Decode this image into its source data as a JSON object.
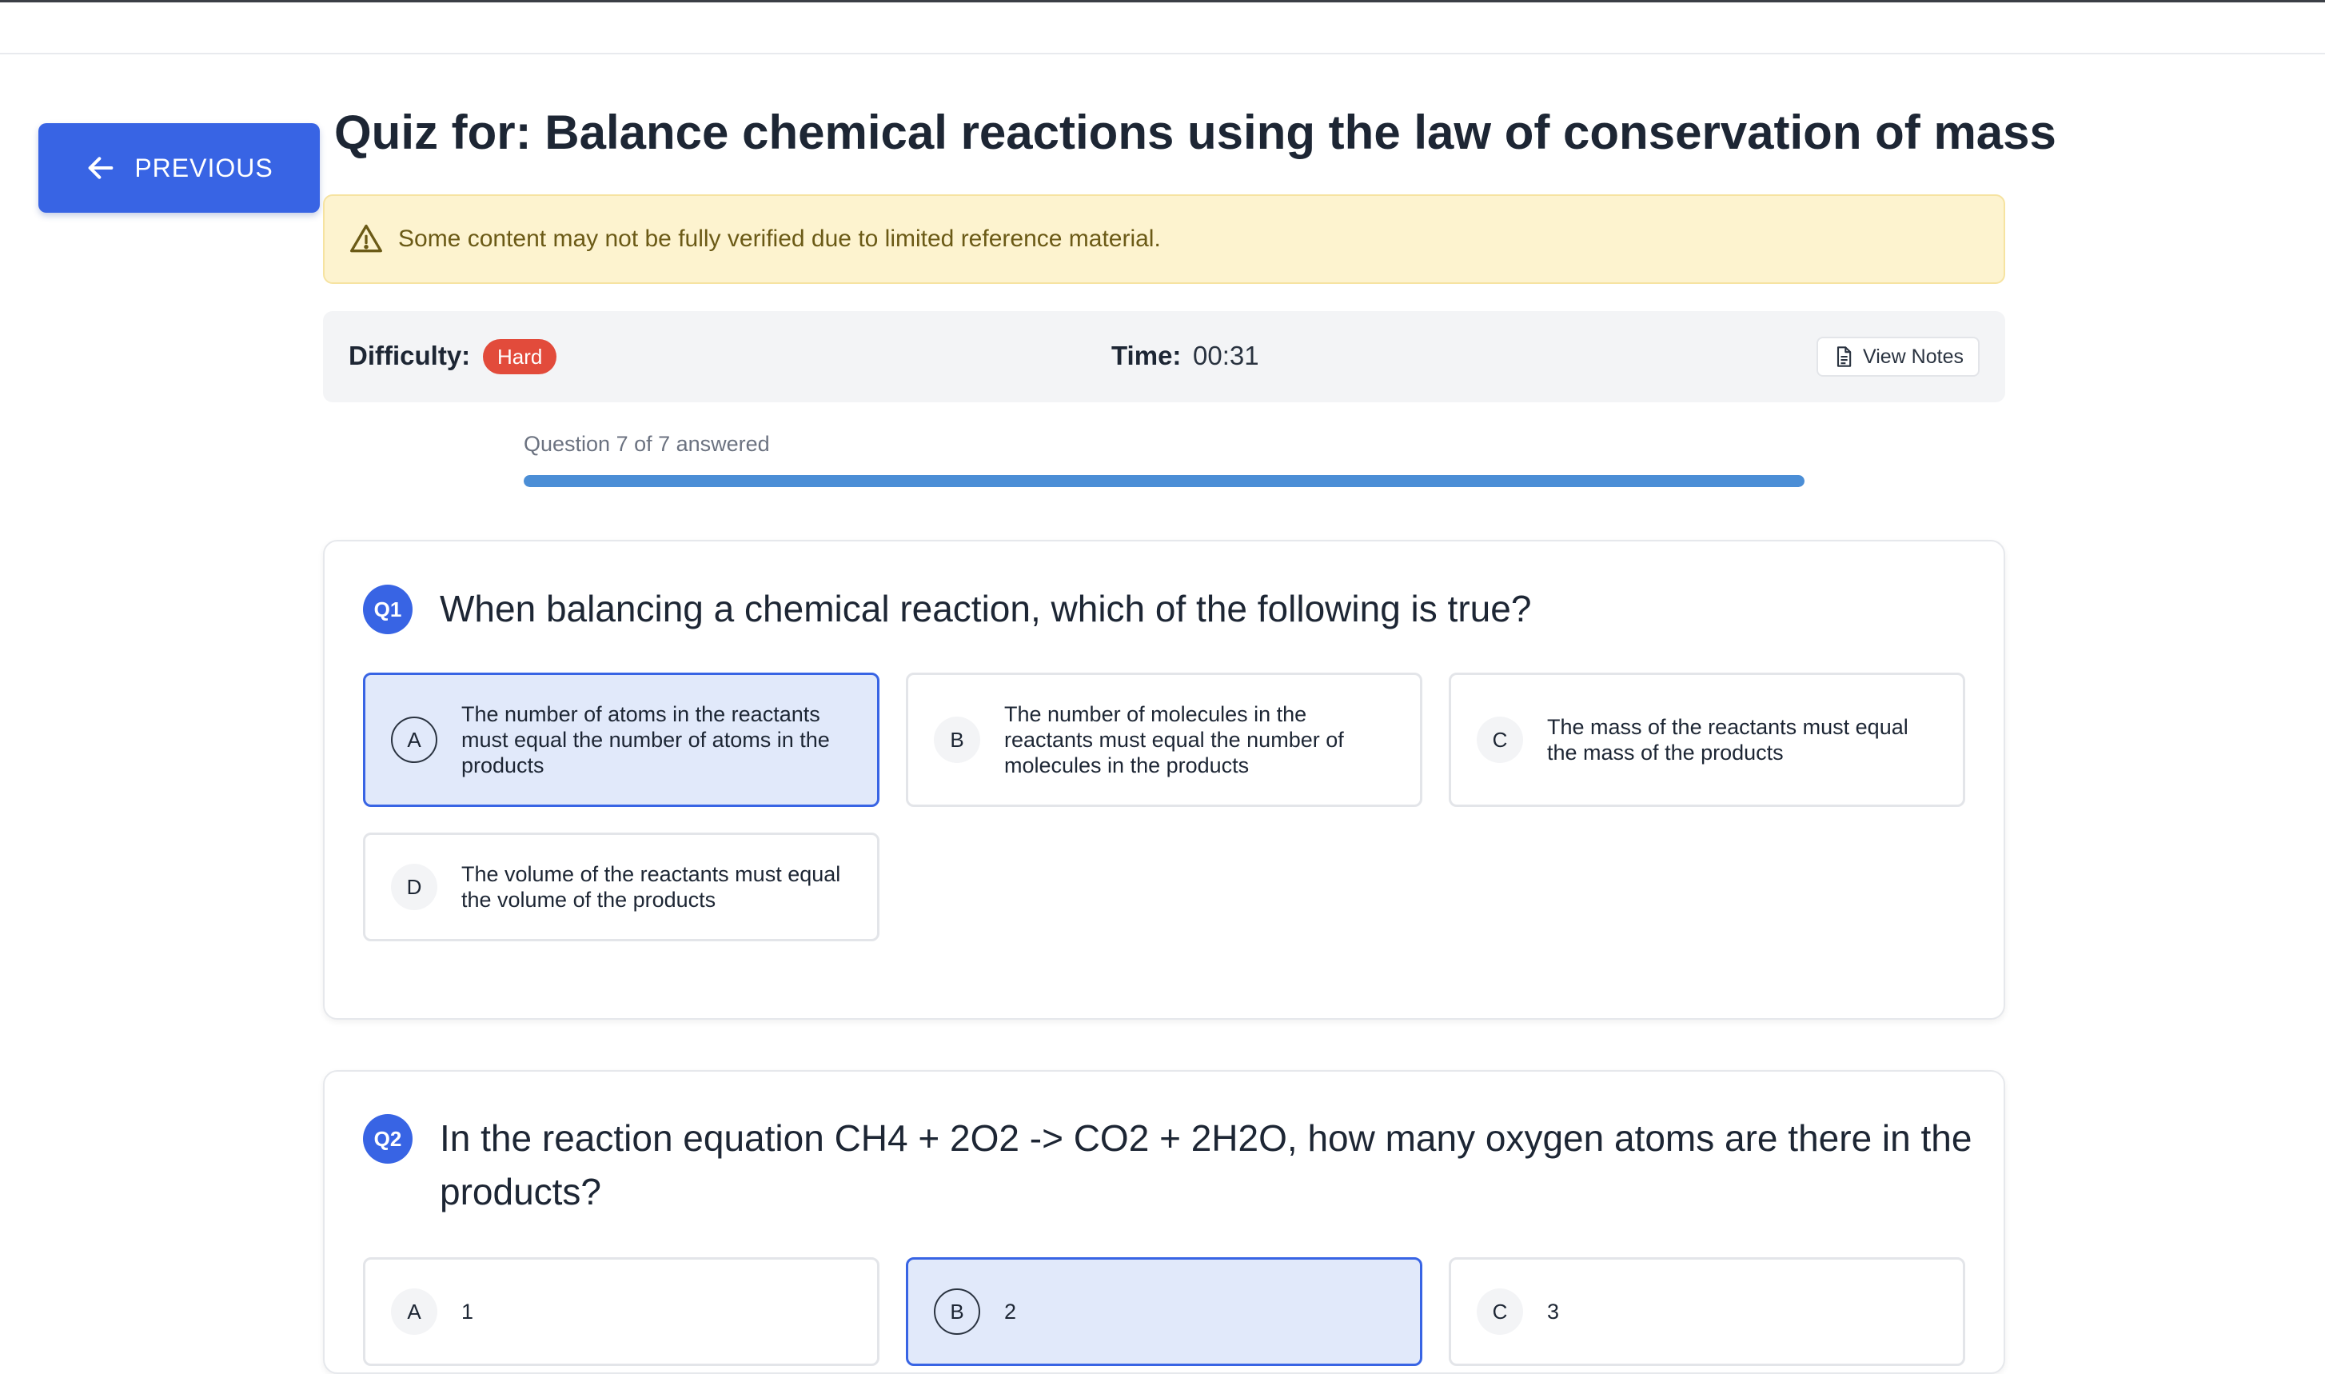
{
  "nav": {
    "previous_label": "PREVIOUS"
  },
  "quiz": {
    "title": "Quiz for: Balance chemical reactions using the law of conservation of mass",
    "warning": "Some content may not be fully verified due to limited reference material."
  },
  "info": {
    "difficulty_label": "Difficulty:",
    "difficulty_value": "Hard",
    "time_label": "Time:",
    "time_value": "00:31",
    "notes_label": "View Notes"
  },
  "progress": {
    "text": "Question 7 of 7 answered",
    "fraction": 1.0
  },
  "questions": [
    {
      "number": "Q1",
      "text": "When balancing a chemical reaction, which of the following is true?",
      "options": [
        {
          "letter": "A",
          "text": "The number of atoms in the reactants must equal the number of atoms in the products",
          "selected": true
        },
        {
          "letter": "B",
          "text": "The number of molecules in the reactants must equal the number of molecules in the products",
          "selected": false
        },
        {
          "letter": "C",
          "text": "The mass of the reactants must equal the mass of the products",
          "selected": false
        },
        {
          "letter": "D",
          "text": "The volume of the reactants must equal the volume of the products",
          "selected": false
        }
      ]
    },
    {
      "number": "Q2",
      "text": "In the reaction equation CH4 + 2O2 -> CO2 + 2H2O, how many oxygen atoms are there in the products?",
      "options": [
        {
          "letter": "A",
          "text": "1",
          "selected": false
        },
        {
          "letter": "B",
          "text": "2",
          "selected": true
        },
        {
          "letter": "C",
          "text": "3",
          "selected": false
        }
      ]
    }
  ],
  "colors": {
    "accent": "#3864e4",
    "warning_bg": "#fdf3cf",
    "badge_hard": "#e24b3b",
    "progress": "#4b8ed6",
    "selected_bg": "#e1e9fa"
  }
}
